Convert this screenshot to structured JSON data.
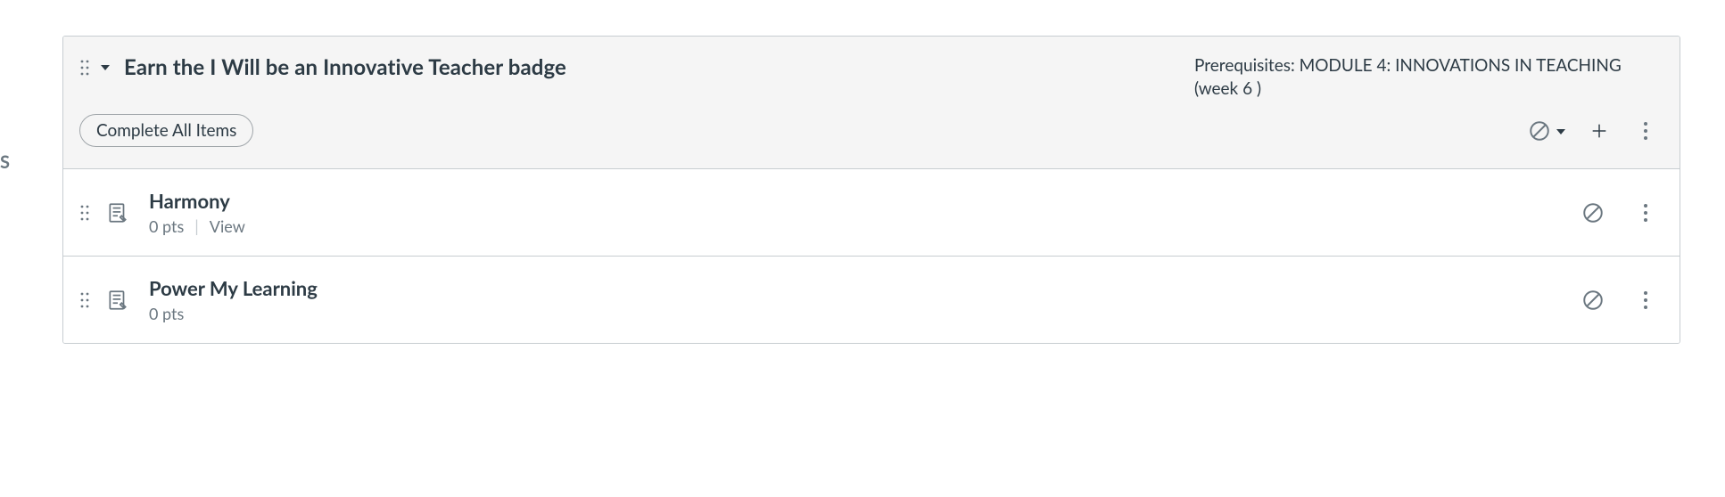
{
  "module": {
    "title": "Earn the I Will be an Innovative Teacher badge",
    "prerequisites_label": "Prerequisites:",
    "prerequisites_value": "MODULE 4: INNOVATIONS IN TEACHING (week 6 )",
    "complete_label": "Complete All Items",
    "items": [
      {
        "title": "Harmony",
        "points": "0 pts",
        "requirement": "View"
      },
      {
        "title": "Power My Learning",
        "points": "0 pts",
        "requirement": ""
      }
    ]
  },
  "offscreen_arrow": "S"
}
